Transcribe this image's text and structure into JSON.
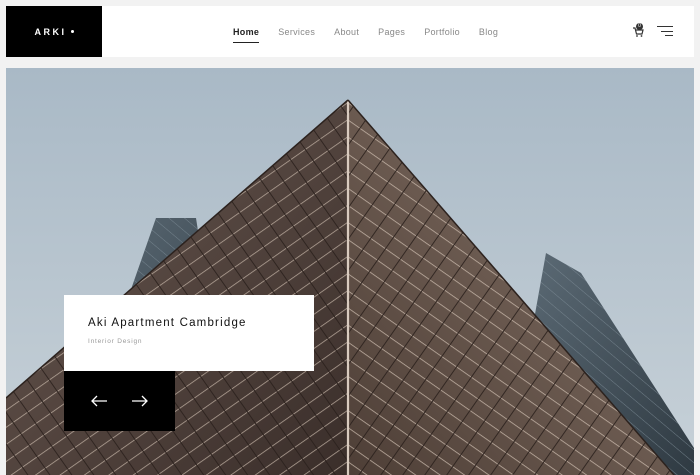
{
  "brand": {
    "logo_text": "ARKI"
  },
  "nav": {
    "items": [
      {
        "label": "Home",
        "active": true
      },
      {
        "label": "Services"
      },
      {
        "label": "About"
      },
      {
        "label": "Pages"
      },
      {
        "label": "Portfolio"
      },
      {
        "label": "Blog"
      }
    ]
  },
  "header_icons": {
    "cart": "cart-icon",
    "cart_count": "0",
    "menu": "menu-icon"
  },
  "hero": {
    "image": "skyscraper-upward-view",
    "caption_title": "Aki Apartment Cambridge",
    "caption_subtitle": "Interior Design"
  },
  "slider": {
    "prev_icon": "arrow-left-icon",
    "next_icon": "arrow-right-icon"
  },
  "colors": {
    "accent": "#000000",
    "nav_active": "#222222",
    "nav_inactive": "#888888",
    "sky": "#b5c2cc"
  }
}
